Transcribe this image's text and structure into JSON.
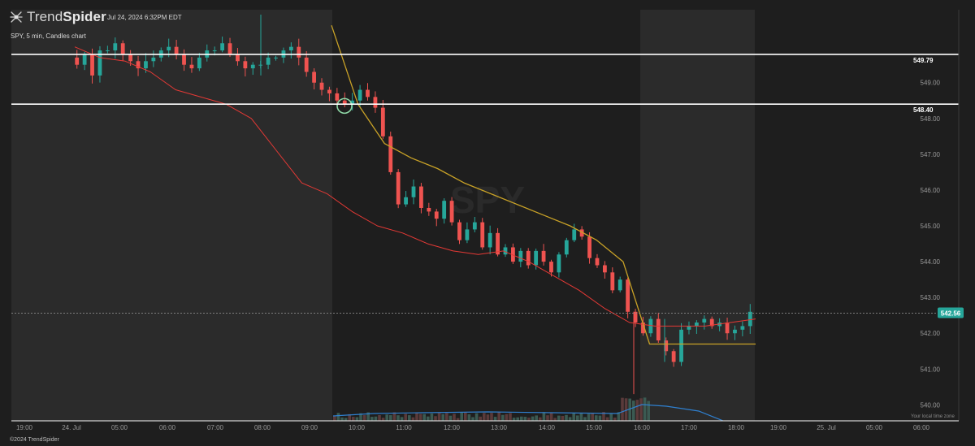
{
  "header": {
    "brand_light": "Trend",
    "brand_bold": "Spider",
    "date": "Jul 24, 2024 6:32PM EDT",
    "description": "SPY, 5 min, Candles chart"
  },
  "footer": {
    "copyright": "©2024 TrendSpider",
    "timezone_note": "Your local time zone"
  },
  "colors": {
    "background": "#1e1e1e",
    "session_shade": "#2b2b2b",
    "bull": "#26a69a",
    "bear": "#ef5350",
    "ema": "#e53935",
    "vwap": "#c9a227",
    "volume_avg": "#2f80d0",
    "level_line": "#ffffff",
    "price_badge": "#26a69a"
  },
  "chart_data": {
    "type": "candlestick",
    "symbol": "SPY",
    "interval": "5 min",
    "watermark": "SPY",
    "x_ticks": [
      "19:00",
      "24. Jul",
      "05:00",
      "06:00",
      "07:00",
      "08:00",
      "09:00",
      "10:00",
      "11:00",
      "12:00",
      "13:00",
      "14:00",
      "15:00",
      "16:00",
      "17:00",
      "18:00",
      "19:00",
      "25. Jul",
      "05:00",
      "06:00"
    ],
    "y_ticks": [
      540.0,
      541.0,
      542.0,
      543.0,
      544.0,
      545.0,
      546.0,
      547.0,
      548.0,
      549.0
    ],
    "ylim": [
      539.6,
      550.9
    ],
    "horizontal_levels": [
      {
        "label": "549.79",
        "value": 549.79
      },
      {
        "label": "548.40",
        "value": 548.4
      }
    ],
    "last_price": {
      "label": "542.56",
      "value": 542.56
    },
    "price_path": [
      549.7,
      549.5,
      549.8,
      549.2,
      549.9,
      549.9,
      550.1,
      549.8,
      549.6,
      549.4,
      549.6,
      549.7,
      549.9,
      550.0,
      549.8,
      549.5,
      549.4,
      549.7,
      549.9,
      549.9,
      550.1,
      549.8,
      549.6,
      549.4,
      549.5,
      549.5,
      549.7,
      549.7,
      549.9,
      550.0,
      549.7,
      549.3,
      549.0,
      548.8,
      548.7,
      548.5,
      548.4,
      548.5,
      548.8,
      548.6,
      548.3,
      547.5,
      546.5,
      545.6,
      545.8,
      546.1,
      545.5,
      545.4,
      545.2,
      545.7,
      545.1,
      544.6,
      544.9,
      545.1,
      544.4,
      544.8,
      544.2,
      544.4,
      544.0,
      544.3,
      543.9,
      544.3,
      544.0,
      543.7,
      544.2,
      544.6,
      544.9,
      544.7,
      544.1,
      543.9,
      543.7,
      543.2,
      543.5,
      542.6,
      542.3,
      542.0,
      542.4,
      541.8,
      541.5,
      541.2,
      542.1,
      542.2,
      542.3,
      542.4,
      542.2,
      542.3,
      542.0,
      542.1,
      542.2,
      542.6
    ],
    "vwap_path": [
      550.6,
      548.4,
      547.3,
      546.9,
      546.6,
      546.2,
      545.9,
      545.6,
      545.3,
      545.0,
      544.6,
      544.0,
      541.7,
      541.7,
      541.7,
      541.7,
      541.7
    ],
    "ema_path": [
      550.0,
      549.7,
      549.6,
      549.3,
      548.8,
      548.6,
      548.4,
      548.0,
      547.1,
      546.2,
      545.9,
      545.4,
      545.0,
      544.8,
      544.5,
      544.3,
      544.2,
      544.3,
      544.0,
      543.6,
      543.2,
      542.7,
      542.3,
      542.2,
      542.2,
      542.2,
      542.3,
      542.4
    ],
    "highlight_circle": {
      "value": 548.35,
      "time": "09:50"
    }
  }
}
